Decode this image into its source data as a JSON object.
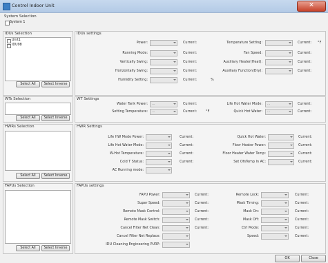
{
  "window": {
    "title": "Control Indoor Unit",
    "close_glyph": "✕"
  },
  "system": {
    "label": "System Selection",
    "checkbox_label": "System 1"
  },
  "idu": {
    "selection_title": "IDUs Selection",
    "list": [
      "Unit1",
      "IDU98"
    ],
    "select_all": "Select All",
    "select_inverse": "Select Inverse",
    "settings_title": "IDUs settings",
    "left_rows": [
      "Power:",
      "Running Mode:",
      "Vertically Swing:",
      "Horizontally Swing:",
      "Humidity Setting:"
    ],
    "right_rows": [
      "Temperature Setting:",
      "Fan Speed:",
      "Auxiliary Heater(Heat):",
      "Auxiliary Function(Dry):",
      ""
    ],
    "right_current": [
      "Current:",
      "Current:",
      "Current:",
      "Current:",
      "%"
    ],
    "current": "Current:",
    "degree": "°F"
  },
  "wt": {
    "selection_title": "WTs Selection",
    "select_all": "Select All",
    "select_inverse": "Select Inverse",
    "settings_title": "WT Settings",
    "left_rows": [
      "Water Tank Power:",
      "Setting Temperature:"
    ],
    "left_extra": [
      "",
      "°F"
    ],
    "right_rows": [
      "Life Hot Water Mode:",
      "Quick Hot Water:"
    ],
    "current": "Current:"
  },
  "hwr": {
    "selection_title": "HWRs Selection",
    "select_all": "Select All",
    "select_inverse": "Select Inverse",
    "settings_title": "HWR Settings",
    "left_rows": [
      "Life HW Mode Power:",
      "Life Hot Water Mode:",
      "W-Hot Temperature:",
      "Cold T Status:",
      "AC Running mode:"
    ],
    "right_rows": [
      "Quick Hot Water:",
      "Floor Heater Power:",
      "Floor Heater Water Temp:",
      "Set OfsTemp In AC:",
      ""
    ],
    "current": "Current:"
  },
  "fapu": {
    "selection_title": "FAPUs Selection",
    "select_all": "Select All",
    "select_inverse": "Select Inverse",
    "settings_title": "FAPUs settings",
    "left_rows": [
      "FAPU Power:",
      "Super Speed:",
      "Remote Mask Control:",
      "Remote Mask Switch:",
      "Cancel Filter Net Clean:",
      "Cancel Filter Net Replace:",
      "IDU Cleaning Engineering PURP:"
    ],
    "right_rows": [
      "Remote Lock:",
      "Mask Timing:",
      "Mask On:",
      "Mask Off:",
      "Ctrl Mode:",
      "Speed:",
      ""
    ],
    "current": "Current:"
  },
  "footer": {
    "ok": "OK",
    "close": "Close"
  }
}
